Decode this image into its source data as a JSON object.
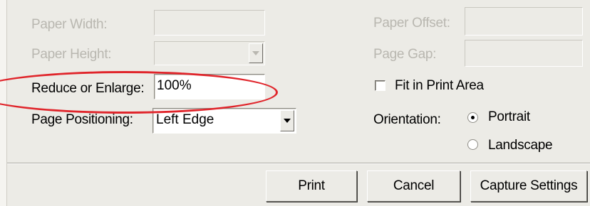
{
  "paper_width": {
    "label": "Paper Width:",
    "value": ""
  },
  "paper_height": {
    "label": "Paper Height:",
    "value": ""
  },
  "reduce_enlarge": {
    "label": "Reduce or Enlarge:",
    "value": "100%"
  },
  "page_positioning": {
    "label": "Page Positioning:",
    "value": "Left Edge"
  },
  "paper_offset": {
    "label": "Paper Offset:",
    "value": ""
  },
  "page_gap": {
    "label": "Page Gap:",
    "value": ""
  },
  "fit_print_area": {
    "label": "Fit in Print Area",
    "checked": false
  },
  "orientation": {
    "label": "Orientation:",
    "options": [
      {
        "label": "Portrait",
        "selected": true
      },
      {
        "label": "Landscape",
        "selected": false
      }
    ]
  },
  "buttons": {
    "print": "Print",
    "cancel": "Cancel",
    "capture_settings": "Capture Settings"
  },
  "annotation": {
    "highlight_color": "#e0252b"
  }
}
